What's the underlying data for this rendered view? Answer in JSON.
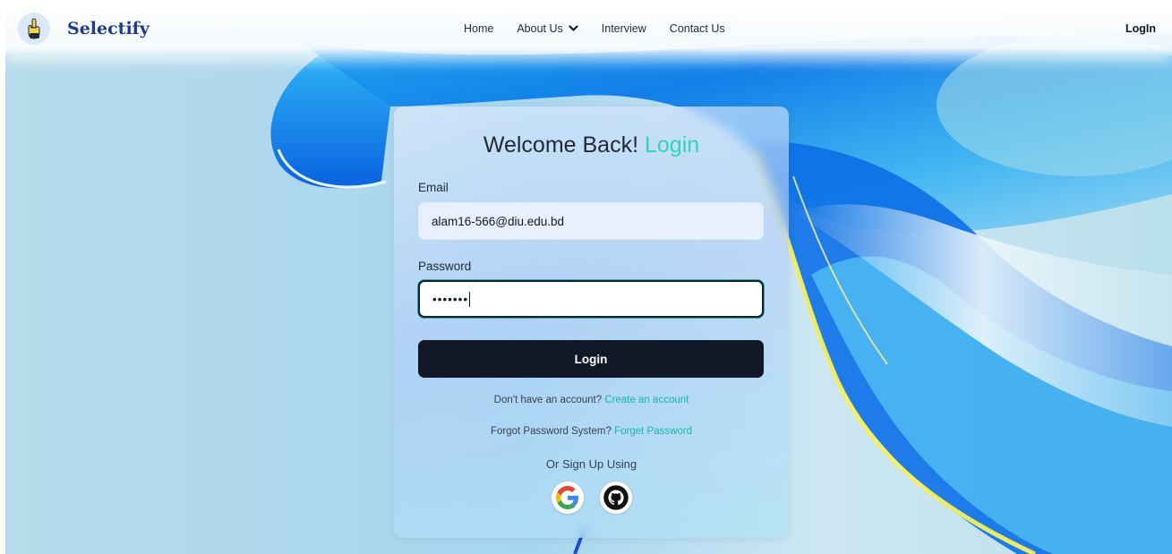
{
  "brand": {
    "name": "Selectify",
    "logo_icon": "pointing-hand-icon"
  },
  "nav": {
    "links": [
      {
        "label": "Home"
      },
      {
        "label": "About Us",
        "icon": "chevron-down-icon"
      },
      {
        "label": "Interview"
      },
      {
        "label": "Contact Us"
      }
    ],
    "login_label": "LogIn"
  },
  "card": {
    "title_prefix": "Welcome Back!",
    "title_accent": "Login",
    "email": {
      "label": "Email",
      "value": "alam16-566@diu.edu.bd"
    },
    "password": {
      "label": "Password",
      "masked_value": "•••••••"
    },
    "login_button": "Login",
    "signup_prompt": {
      "text": "Don't have an account?",
      "link": "Create an account"
    },
    "forgot_prompt": {
      "text": "Forgot Password System?",
      "link": "Forget Password"
    },
    "or_text": "Or Sign Up Using",
    "social_icons": [
      "google-icon",
      "github-icon"
    ]
  },
  "colors": {
    "brand": "#1e3a8a",
    "accent": "#2dd4bf",
    "button": "#111827"
  }
}
